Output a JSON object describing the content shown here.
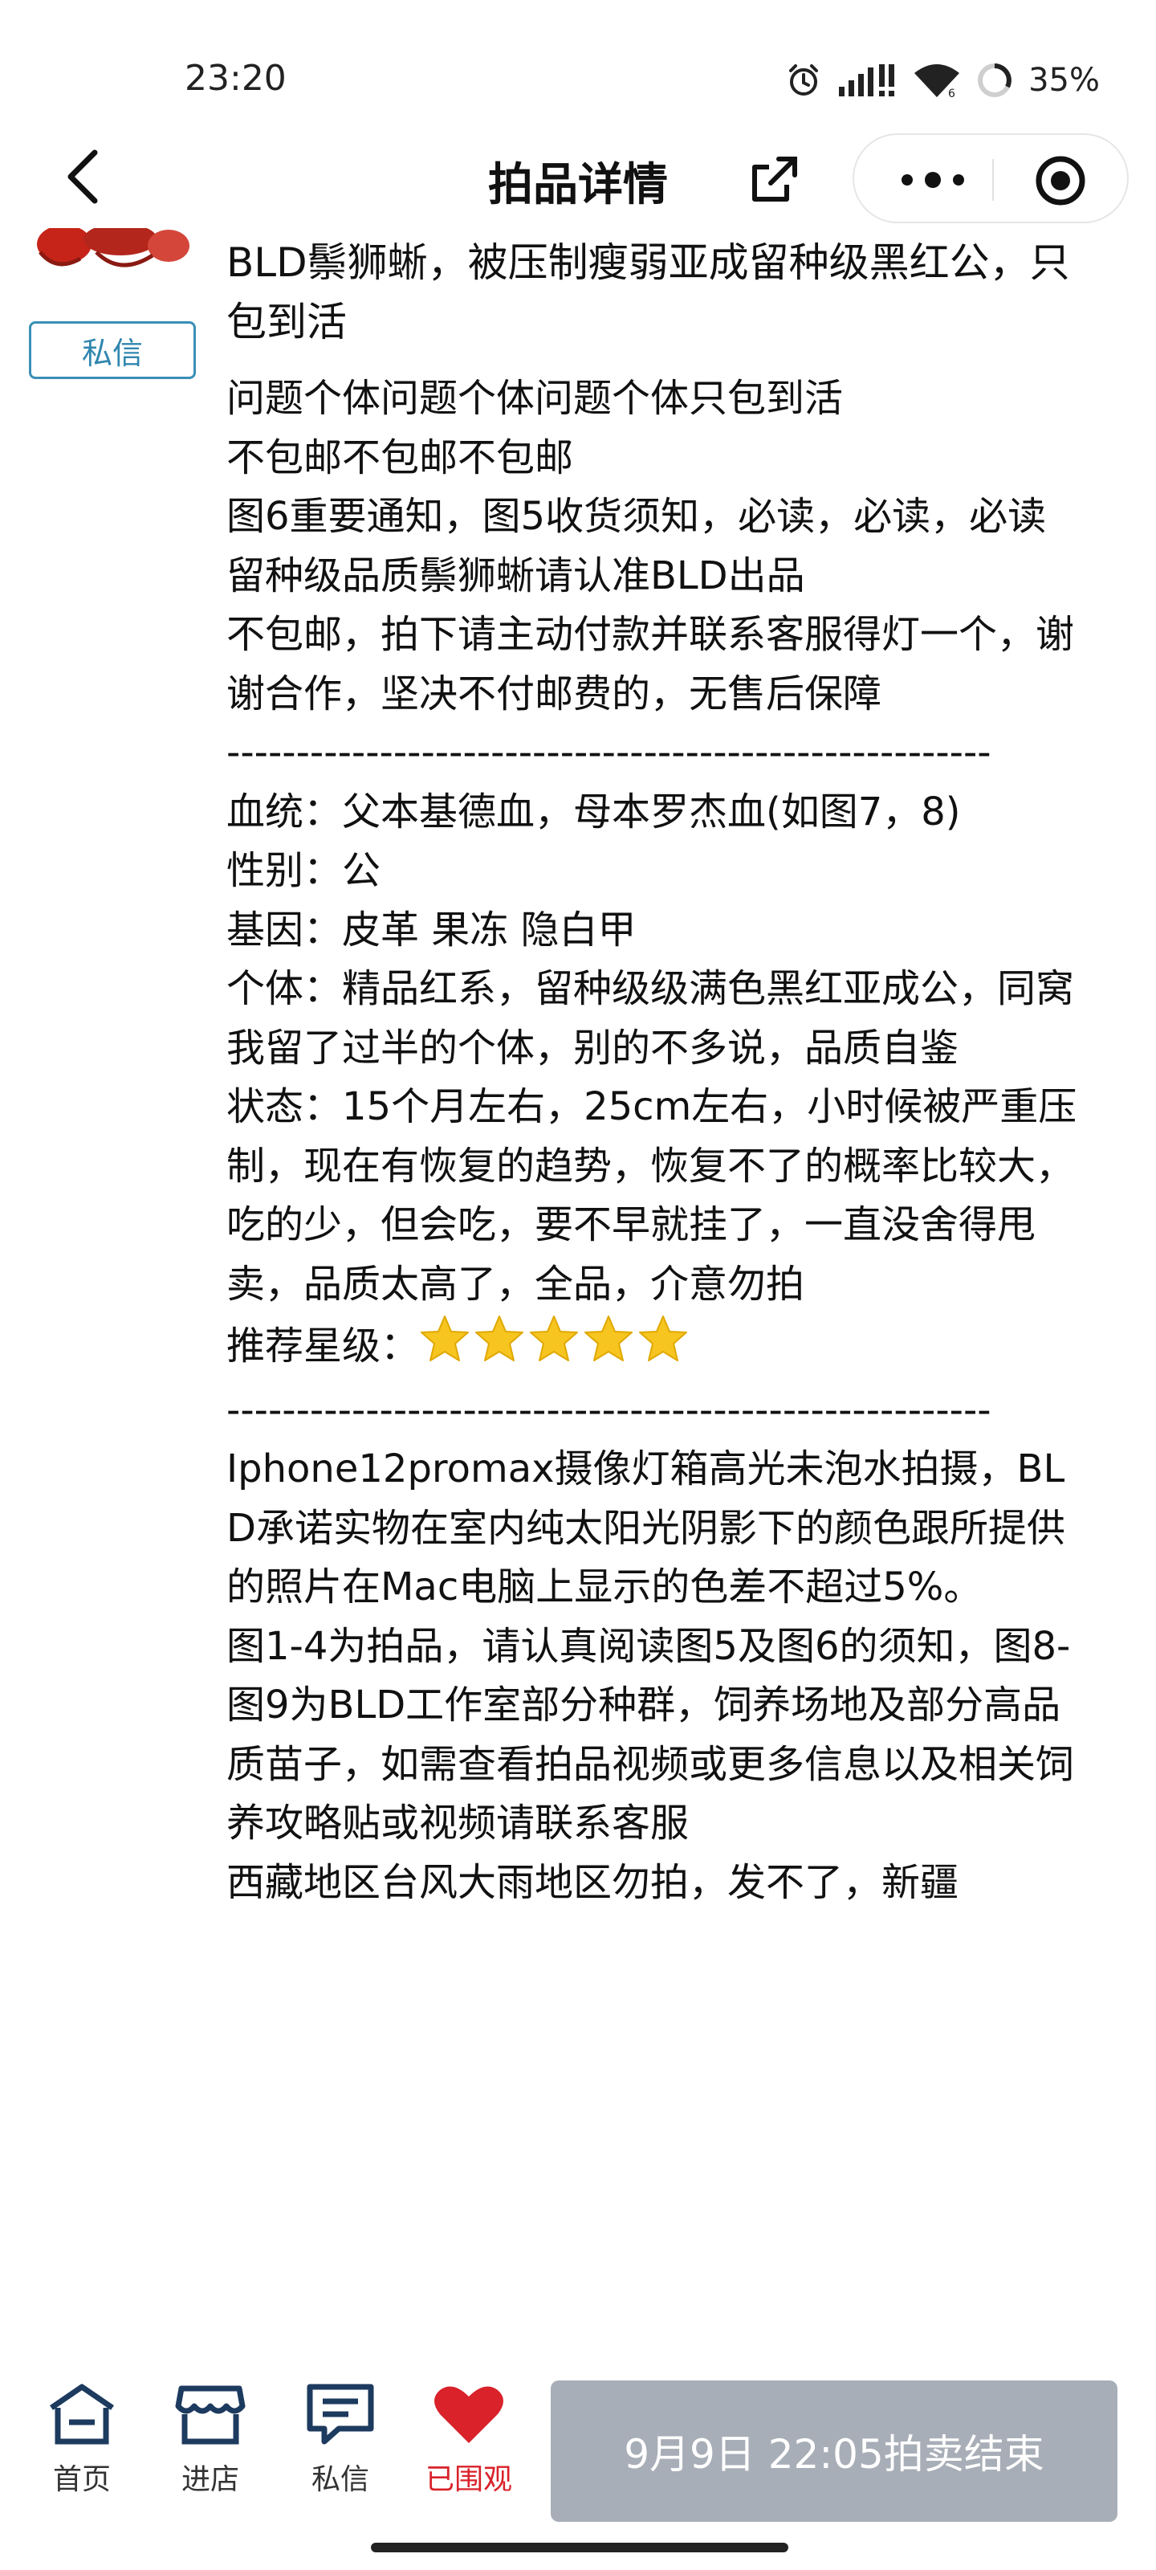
{
  "status_bar": {
    "time": "23:20",
    "battery": "35%",
    "icons": [
      "alarm-icon",
      "signal-icon",
      "wifi-icon",
      "battery-icon"
    ]
  },
  "nav": {
    "title": "拍品详情",
    "icons": [
      "back-chevron-icon",
      "share-icon",
      "more-dots-icon",
      "close-target-icon"
    ]
  },
  "seller": {
    "dm_button": "私信"
  },
  "item": {
    "title": "BLD鬃狮蜥，被压制瘦弱亚成留种级黑红公，只包到活",
    "description_lines": [
      "问题个体问题个体问题个体只包到活",
      "不包邮不包邮不包邮",
      "图6重要通知，图5收货须知，必读，必读，必读",
      "留种级品质鬃狮蜥请认准BLD出品",
      "不包邮，拍下请主动付款并联系客服得灯一个，谢谢合作，坚决不付邮费的，无售后保障",
      "-------------------------------------------------------",
      "血统：父本基德血，母本罗杰血(如图7，8)",
      "性别：公",
      "基因：皮革 果冻 隐白甲",
      "个体：精品红系，留种级级满色黑红亚成公，同窝我留了过半的个体，别的不多说，品质自鉴",
      "状态：15个月左右，25cm左右，小时候被严重压制，现在有恢复的趋势，恢复不了的概率比较大，吃的少，但会吃，要不早就挂了，一直没舍得甩卖，品质太高了，全品，介意勿拍"
    ],
    "rating_label": "推荐星级：",
    "rating_stars": 5,
    "description_lines_2": [
      "-------------------------------------------------------",
      "Iphone12promax摄像灯箱高光未泡水拍摄，BLD承诺实物在室内纯太阳光阴影下的颜色跟所提供的照片在Mac电脑上显示的色差不超过5%。",
      "图1-4为拍品，请认真阅读图5及图6的须知，图8-图9为BLD工作室部分种群，饲养场地及部分高品质苗子，如需查看拍品视频或更多信息以及相关饲养攻略贴或视频请联系客服",
      "西藏地区台风大雨地区勿拍，发不了，新疆"
    ]
  },
  "bottom_bar": {
    "tabs": [
      {
        "label": "首页",
        "icon": "home-shop-icon"
      },
      {
        "label": "进店",
        "icon": "store-icon"
      },
      {
        "label": "私信",
        "icon": "message-icon"
      },
      {
        "label": "已围观",
        "icon": "heart-icon"
      }
    ],
    "auction_end": "9月9日 22:05拍卖结束",
    "colors": {
      "accent_red": "#d9222a",
      "end_button": "#a8aeb7",
      "dm_border": "#3a8fb7"
    }
  }
}
